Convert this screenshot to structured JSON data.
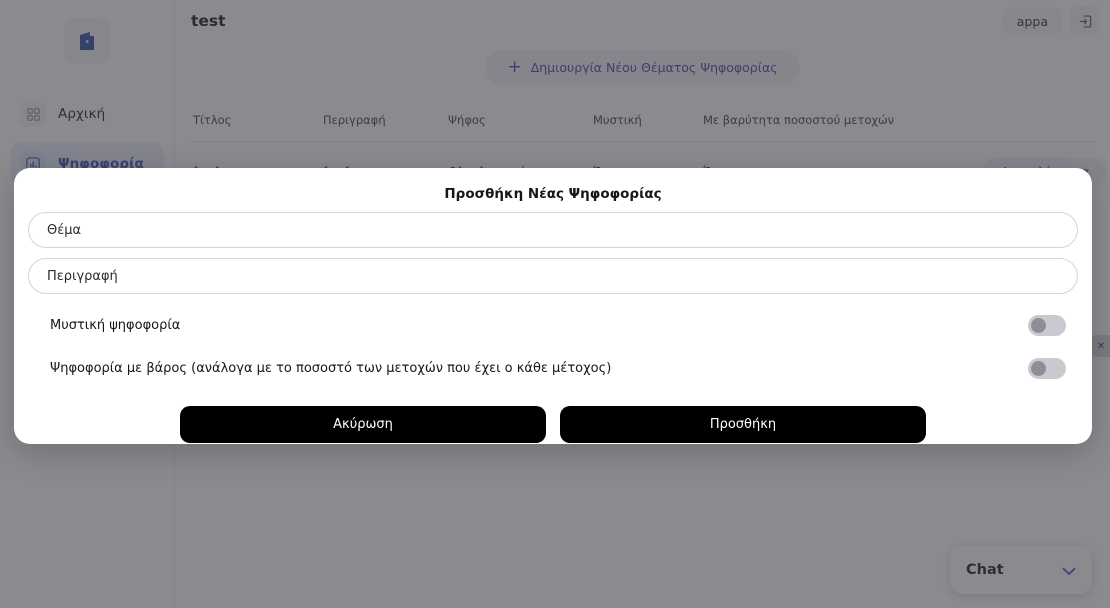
{
  "sidebar": {
    "logo_icon": "door-logo-icon",
    "items": [
      {
        "label": "Αρχική",
        "icon": "grid-icon",
        "active": false
      },
      {
        "label": "Ψηφοφορία",
        "icon": "chart-icon",
        "active": true
      }
    ]
  },
  "topbar": {
    "title": "test",
    "user_label": "appa",
    "logout_icon": "logout-icon"
  },
  "main": {
    "create_button": {
      "label": "Δημιουργία Νέου Θέματος Ψηφοφορίας",
      "plus": "+"
    },
    "table": {
      "headers": [
        "Τίτλος",
        "Περιγραφή",
        "Ψήφος",
        "Μυστική",
        "Με βαρύτητα ποσοστού μετοχών",
        ""
      ],
      "rows": [
        {
          "title": "fewfwe",
          "description": "fewfwe",
          "vote": "Ολοκληρωμένη",
          "secret": "Όχι",
          "weighted": "Όχι",
          "action": "Αποτελέσματα"
        }
      ]
    }
  },
  "chat": {
    "label": "Chat",
    "chevron_icon": "chevron-down-icon",
    "accent": "#5b48e0"
  },
  "edge": {
    "close_icon": "close-icon",
    "close_glyph": "✕"
  },
  "modal": {
    "title": "Προσθήκη Νέας Ψηφοφορίας",
    "fields": [
      {
        "name": "topic",
        "placeholder": "Θέμα",
        "value": ""
      },
      {
        "name": "description",
        "placeholder": "Περιγραφή",
        "value": ""
      }
    ],
    "switches": [
      {
        "label": "Μυστική ψηφοφορία",
        "on": false
      },
      {
        "label": "Ψηφοφορία με βάρος (ανάλογα με το ποσοστό των μετοχών που έχει ο κάθε μέτοχος)",
        "on": false
      }
    ],
    "cancel_label": "Ακύρωση",
    "submit_label": "Προσθήκη"
  },
  "colors": {
    "accent_purple": "#4b3fa8",
    "logo_blue": "#2b4b9b",
    "nav_active_text": "#2f4bb0",
    "button_black": "#000000"
  }
}
